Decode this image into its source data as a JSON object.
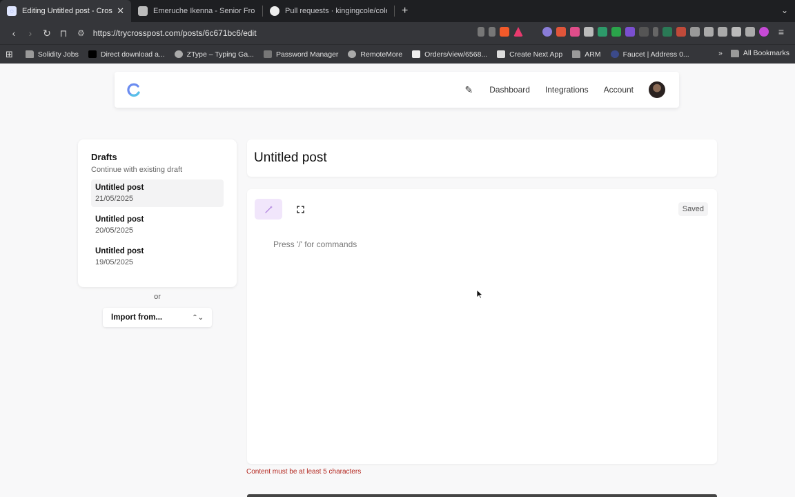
{
  "browser": {
    "tabs": [
      {
        "title": "Editing Untitled post - Crossp",
        "active": true
      },
      {
        "title": "Emeruche Ikenna - Senior Fronte",
        "active": false
      },
      {
        "title": "Pull requests · kingingcole/coleru",
        "active": false
      }
    ],
    "new_tab": "+",
    "url": "https://trycrosspost.com/posts/6c671bc6/edit",
    "bookmarks": [
      "Solidity Jobs",
      "Direct download a...",
      "ZType – Typing Ga...",
      "Password Manager",
      "RemoteMore",
      "Orders/view/6568...",
      "Create Next App",
      "ARM",
      "Faucet | Address 0..."
    ],
    "all_bookmarks": "All Bookmarks"
  },
  "app": {
    "nav": {
      "dashboard": "Dashboard",
      "integrations": "Integrations",
      "account": "Account"
    },
    "drafts": {
      "title": "Drafts",
      "subtitle": "Continue with existing draft",
      "items": [
        {
          "title": "Untitled post",
          "date": "21/05/2025"
        },
        {
          "title": "Untitled post",
          "date": "20/05/2025"
        },
        {
          "title": "Untitled post",
          "date": "19/05/2025"
        }
      ]
    },
    "or_label": "or",
    "import_label": "Import from...",
    "post_title": "Untitled post",
    "editor": {
      "status": "Saved",
      "placeholder": "Press '/' for commands"
    },
    "error": "Content must be at least 5 characters",
    "colors": {
      "accent": "#b68be0",
      "error": "#b3261e",
      "logo": "#6b8cf0"
    }
  }
}
